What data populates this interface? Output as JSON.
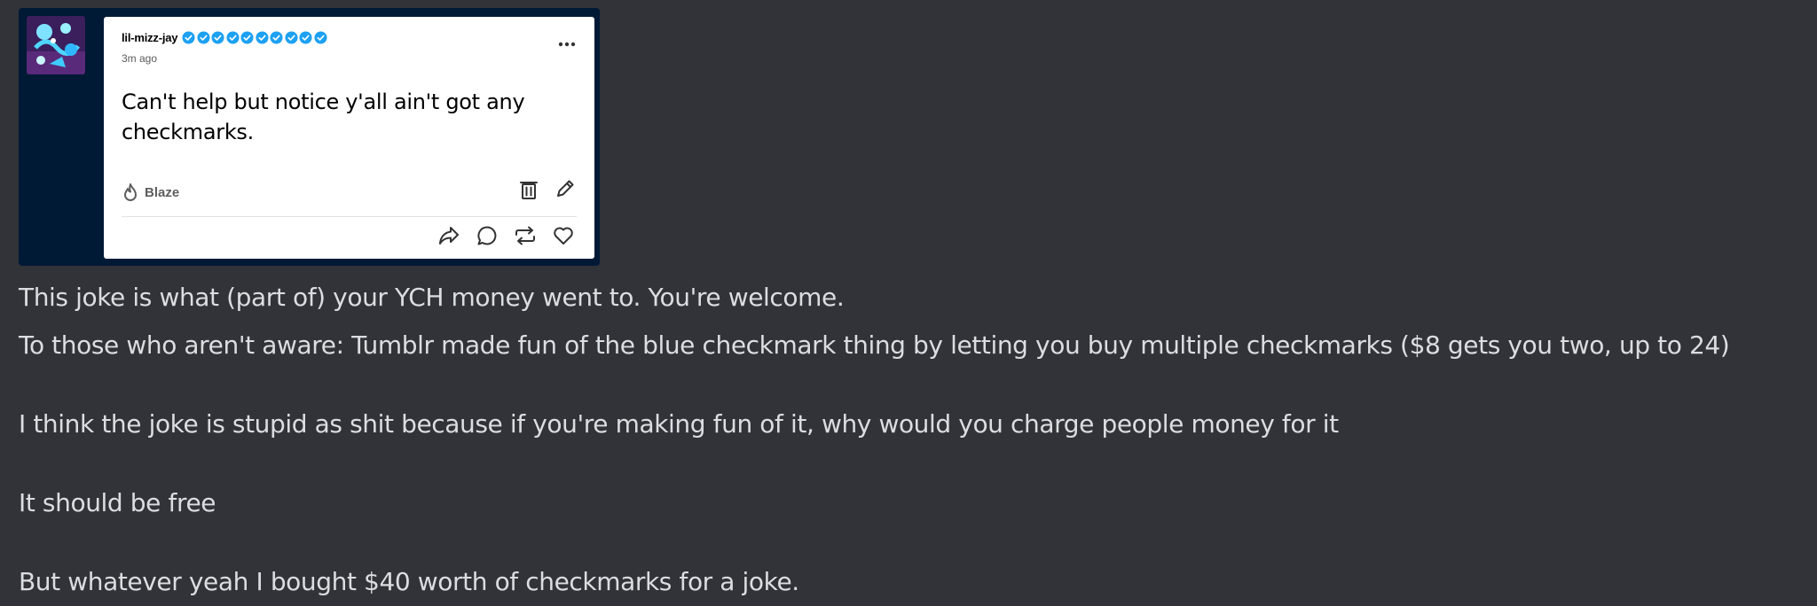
{
  "tumblr_post": {
    "username": "lil-mizz-jay",
    "checkmark_count": 10,
    "timestamp": "3m ago",
    "body": "Can't help but notice y'all ain't got any checkmarks.",
    "blaze_label": "Blaze",
    "icons": {
      "more": "more-horizontal-icon",
      "blaze": "flame-icon",
      "delete": "trash-icon",
      "edit": "pencil-icon",
      "share": "share-arrow-icon",
      "reply": "speech-bubble-icon",
      "reblog": "reblog-icon",
      "like": "heart-icon"
    },
    "colors": {
      "checkmark": "#1da1f2",
      "card_bg": "#ffffff",
      "embed_bg": "#001935"
    }
  },
  "message": {
    "lines": [
      "This joke is what (part of) your YCH money went to. You're welcome.",
      "To those who aren't aware: Tumblr made fun of the blue checkmark thing by letting you buy multiple checkmarks ($8 gets you two, up to 24)",
      "I think the joke is stupid as shit because if you're making fun of it, why would you charge people money for it",
      "It should be free",
      "But whatever yeah I bought $40 worth of checkmarks for a joke."
    ]
  },
  "colors": {
    "background": "#313338",
    "text": "#dbdee1"
  }
}
